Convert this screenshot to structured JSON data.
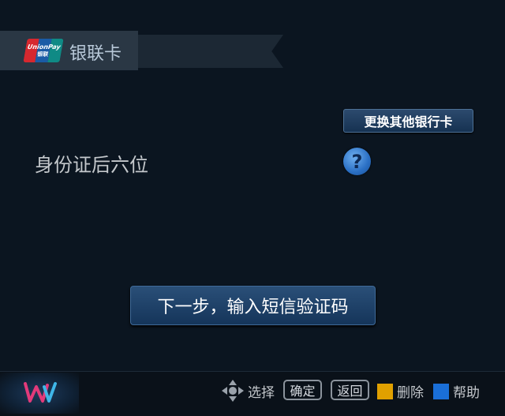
{
  "header": {
    "logo_line1": "UnionPay",
    "logo_line2": "银联",
    "title": "银联卡"
  },
  "main": {
    "switch_card_label": "更换其他银行卡",
    "field_label": "身份证后六位",
    "help_glyph": "?",
    "next_button_label": "下一步，输入短信验证码"
  },
  "footer": {
    "hints": {
      "select": "选择",
      "confirm": "确定",
      "back": "返回",
      "delete": "删除",
      "help": "帮助"
    },
    "colors": {
      "delete_key": "#e0a000",
      "help_key": "#1a6fd8"
    },
    "icons": [
      "app-logo-icon",
      "dpad-icon"
    ]
  }
}
